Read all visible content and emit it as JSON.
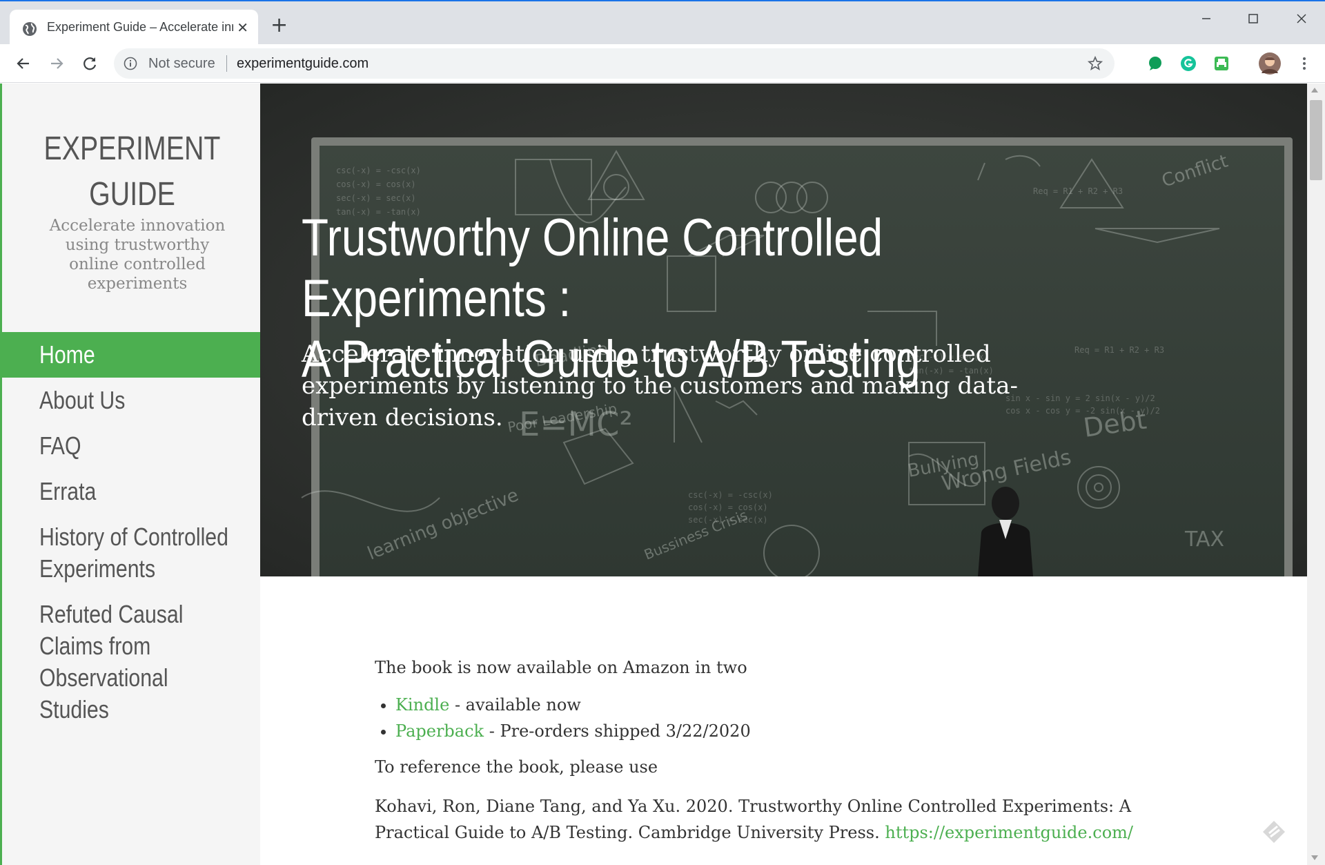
{
  "browser": {
    "tab_title": "Experiment Guide – Accelerate innovation",
    "new_tab": "+",
    "security_label": "Not secure",
    "url": "experimentguide.com"
  },
  "site": {
    "title": "EXPERIMENT GUIDE",
    "tagline": "Accelerate innovation using trustworthy online controlled experiments",
    "accent_color": "#4caf50"
  },
  "nav": [
    {
      "label": "Home",
      "active": true
    },
    {
      "label": "About Us",
      "active": false
    },
    {
      "label": "FAQ",
      "active": false
    },
    {
      "label": "Errata",
      "active": false
    },
    {
      "label": "History of Controlled Experiments",
      "active": false
    },
    {
      "label": "Refuted Causal Claims from Observational Studies",
      "active": false
    }
  ],
  "hero": {
    "title_line1": "Trustworthy Online Controlled Experiments :",
    "title_line2": "A Practical Guide to A/B Testing",
    "subtitle": "Accelerate innovation using trustworthy online controlled experiments by listening to the customers and making data-driven decisions.",
    "chalk": {
      "emc2": "E=MC²",
      "wrong_fields": "Wrong Fields",
      "debt": "Debt",
      "bullying": "Bullying",
      "tax": "TAX",
      "conflict": "Conflict",
      "deadline": "Deadline",
      "poor_leadership": "Poor Leadership",
      "learning_objective": "learning objective",
      "business_crisis": "Bussiness Crisis"
    }
  },
  "content": {
    "intro": "The book is now available on Amazon in two",
    "formats": [
      {
        "link": "Kindle",
        "note": " - available now"
      },
      {
        "link": "Paperback",
        "note": " - Pre-orders shipped 3/22/2020"
      }
    ],
    "reference_intro": "To reference the book, please use",
    "citation_text": "Kohavi, Ron, Diane Tang, and Ya Xu. 2020. Trustworthy Online Controlled Experiments: A Practical Guide to A/B Testing. Cambridge University Press. ",
    "citation_link": "https://experimentguide.com/"
  }
}
